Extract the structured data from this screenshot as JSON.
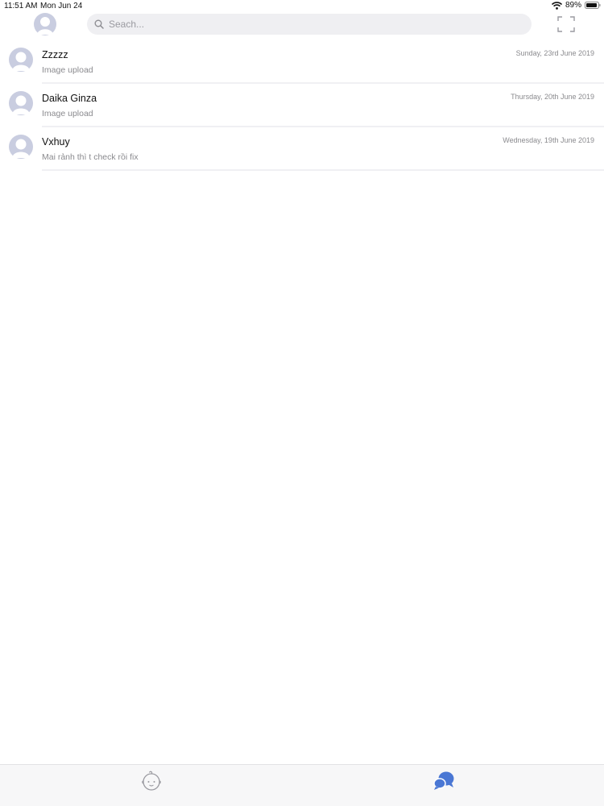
{
  "status_bar": {
    "time": "11:51 AM",
    "date": "Mon Jun 24",
    "battery": "89%"
  },
  "header": {
    "avatar_icon": "user-avatar-icon",
    "search": {
      "placeholder": "Seach...",
      "value": ""
    },
    "scan_icon": "scan-frame-icon"
  },
  "conversations": [
    {
      "name": "Zzzzz",
      "preview": "Image upload",
      "date": "Sunday, 23rd June 2019"
    },
    {
      "name": "Daika Ginza",
      "preview": "Image upload",
      "date": "Thursday, 20th June 2019"
    },
    {
      "name": "Vxhuy",
      "preview": "Mai rảnh thì t check rồi fix",
      "date": "Wednesday, 19th June 2019"
    }
  ],
  "tab_bar": {
    "tabs": [
      {
        "icon": "baby-face-icon",
        "active": false
      },
      {
        "icon": "chat-bubbles-icon",
        "active": true
      }
    ]
  },
  "colors": {
    "accent": "#4a77d4",
    "avatar": "#c9cde0",
    "search_bg": "#efeff2",
    "secondary_text": "#8a8a8e"
  }
}
